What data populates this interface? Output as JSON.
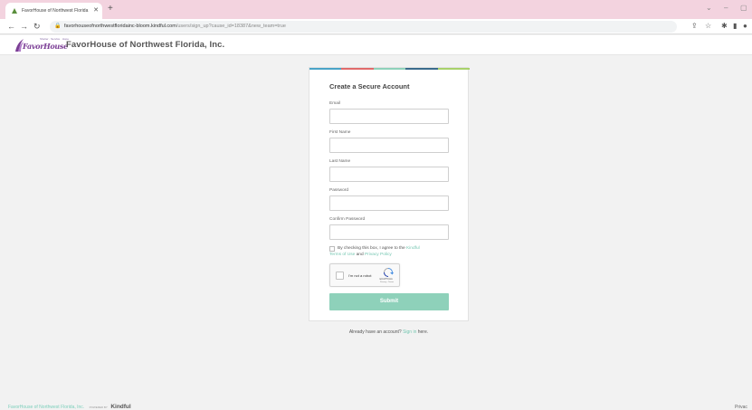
{
  "browser": {
    "tab_title": "FavorHouse of Northwest Florida",
    "tab_close": "✕",
    "new_tab": "+",
    "url_host": "favorhouseofnorthwestfloridainc-bloom.kindful.com",
    "url_path": "/users/sign_up?cause_id=18387&new_team=true",
    "window_controls": [
      "⌄",
      "–",
      "▢"
    ]
  },
  "header": {
    "logo_text": "FavorHouse",
    "logo_tag": "Shelter · Service · Hope",
    "site_title": "FavorHouse of Northwest Florida, Inc."
  },
  "form": {
    "title": "Create a Secure Account",
    "fields": [
      {
        "label": "Email",
        "value": ""
      },
      {
        "label": "First Name",
        "value": ""
      },
      {
        "label": "Last Name",
        "value": ""
      },
      {
        "label": "Password",
        "value": ""
      },
      {
        "label": "Confirm Password",
        "value": ""
      }
    ],
    "agree_prefix": "By checking this box, I agree to the",
    "agree_link_kindful": "Kindful",
    "agree_link_terms": "Terms of Use",
    "agree_and": "and",
    "agree_link_privacy": "Privacy Policy",
    "recaptcha_label": "I'm not a robot",
    "recaptcha_brand": "reCAPTCHA",
    "recaptcha_terms": "Privacy - Terms",
    "submit_label": "Submit"
  },
  "signin": {
    "prefix": "Already have an account?",
    "link": "Sign in",
    "suffix": "here."
  },
  "footer": {
    "org": "FavorHouse of Northwest Florida, Inc.",
    "powered_by": "POWERED BY",
    "brand": "Kindful",
    "privacy": "Privac"
  },
  "colors": {
    "accent": "#8ed1ba",
    "link": "#76c7b2",
    "tabbar": "#f3d3df",
    "stripe": [
      "#4aa3c7",
      "#e06a6a",
      "#8ed1ba",
      "#3a6b8c",
      "#a8d16a"
    ]
  }
}
